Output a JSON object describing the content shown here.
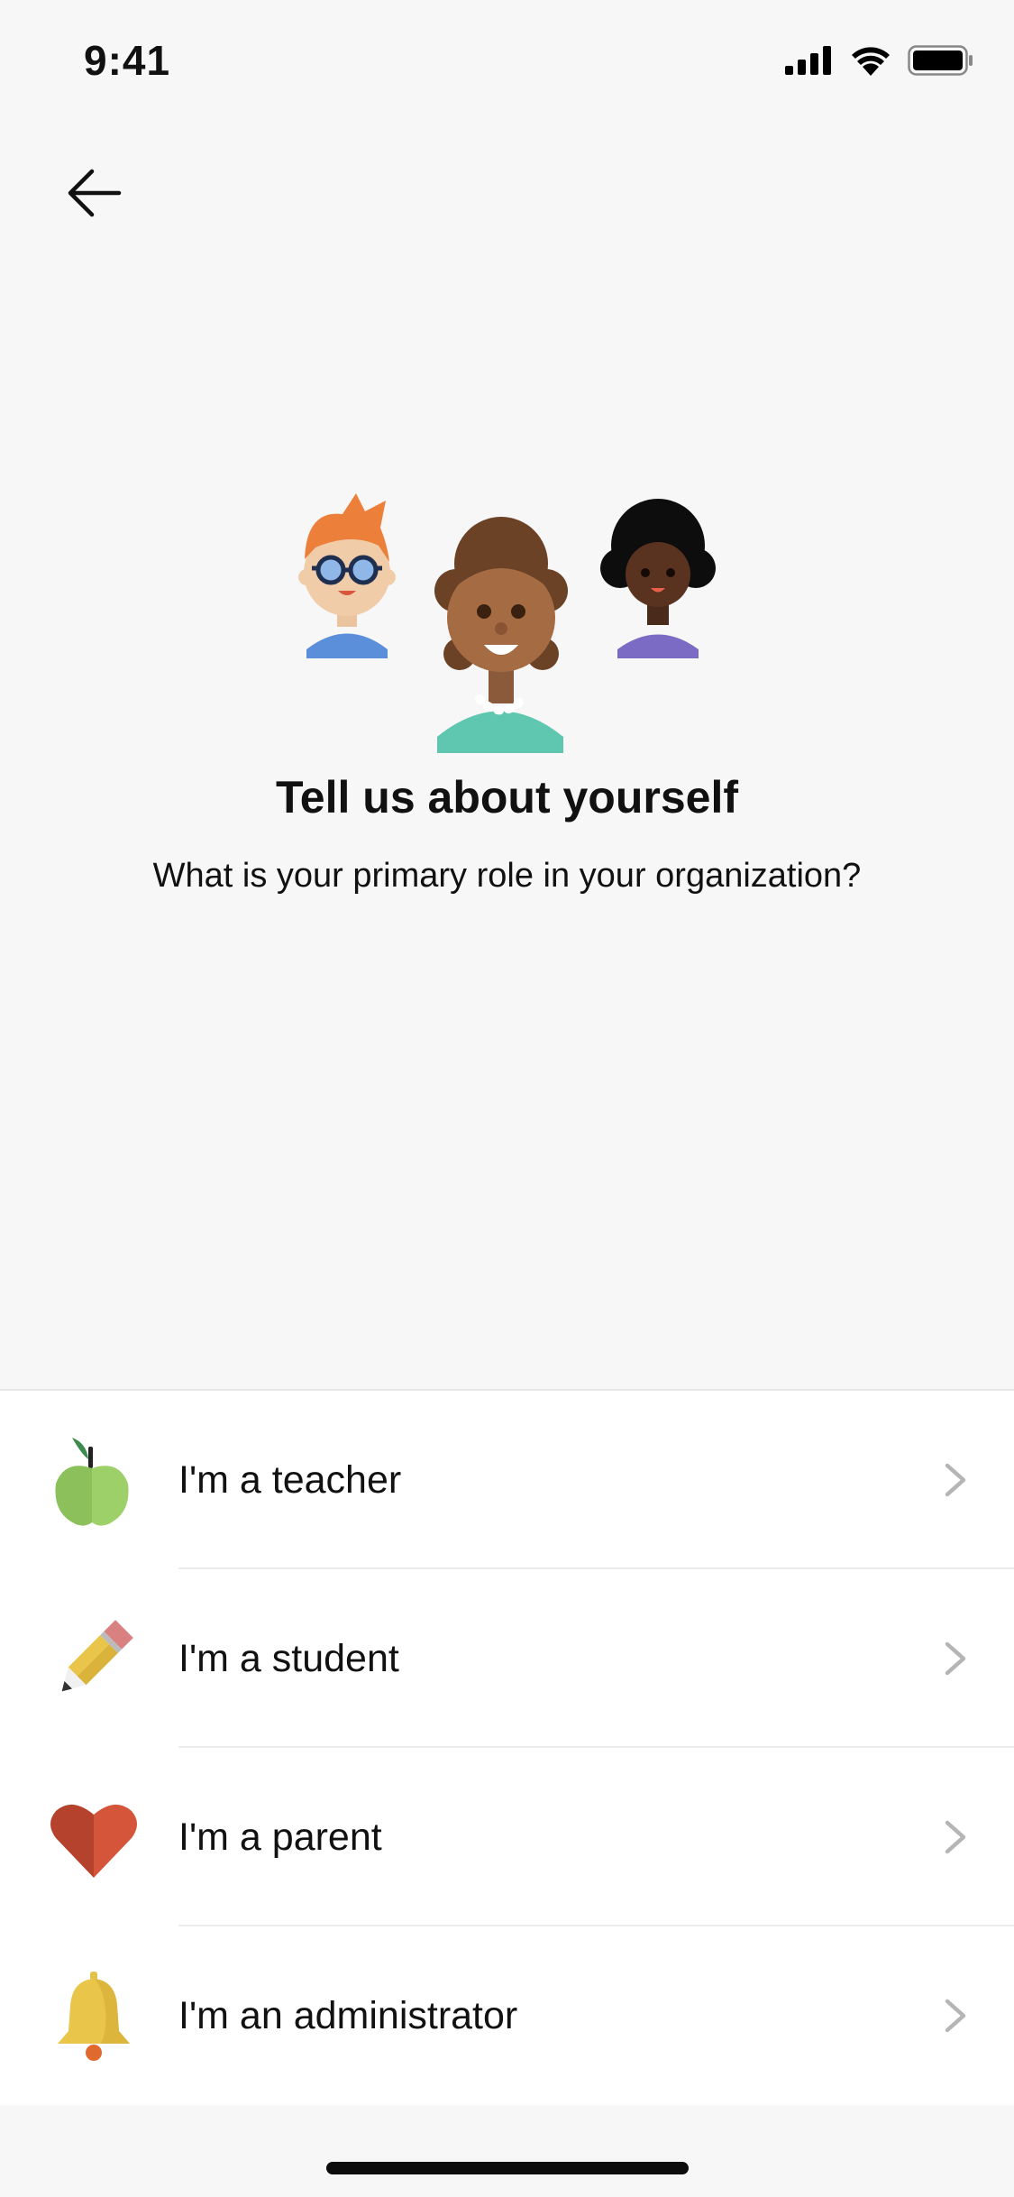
{
  "status_bar": {
    "time": "9:41",
    "icons": [
      "signal-icon",
      "wifi-icon",
      "battery-icon"
    ]
  },
  "nav": {
    "back_icon": "arrow-left-icon"
  },
  "hero": {
    "illustration": "people-illustration"
  },
  "heading": {
    "title": "Tell us about yourself",
    "subtitle": "What is your primary role in your organization?"
  },
  "roles": [
    {
      "label": "I'm a teacher",
      "icon": "apple-icon"
    },
    {
      "label": "I'm a student",
      "icon": "pencil-icon"
    },
    {
      "label": "I'm a parent",
      "icon": "heart-icon"
    },
    {
      "label": "I'm an administrator",
      "icon": "bell-icon"
    }
  ],
  "colors": {
    "background": "#f7f7f7",
    "list_background": "#ffffff",
    "chevron": "#b5b5b5"
  }
}
